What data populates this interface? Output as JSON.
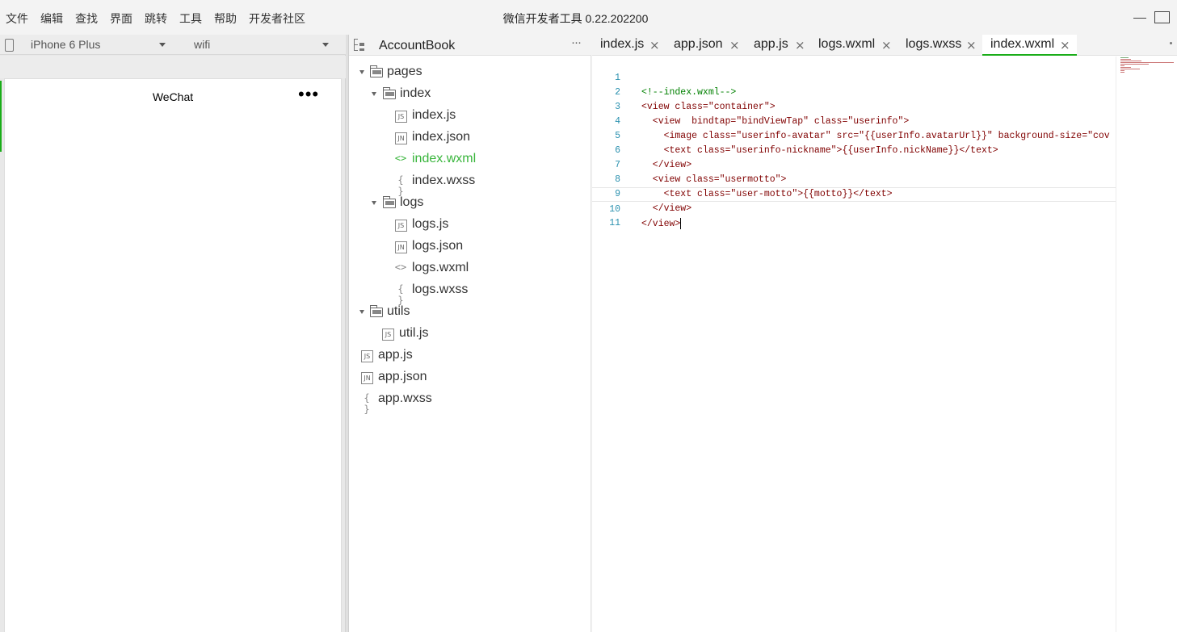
{
  "menu": [
    "文件",
    "编辑",
    "查找",
    "界面",
    "跳转",
    "工具",
    "帮助",
    "开发者社区"
  ],
  "app_title": "微信开发者工具 0.22.202200",
  "simulator": {
    "device": "iPhone 6 Plus",
    "network": "wifi",
    "nav_title": "WeChat",
    "nav_more": "•••"
  },
  "explorer": {
    "project_name": "AccountBook",
    "more": "···",
    "tree": [
      {
        "label": "pages",
        "kind": "folder"
      },
      {
        "label": "index",
        "kind": "folder"
      },
      {
        "label": "index.js",
        "kind": "js",
        "icon": "JS"
      },
      {
        "label": "index.json",
        "kind": "json",
        "icon": "JN"
      },
      {
        "label": "index.wxml",
        "kind": "wxml",
        "icon": "<>"
      },
      {
        "label": "index.wxss",
        "kind": "wxss",
        "icon": "{ }"
      },
      {
        "label": "logs",
        "kind": "folder"
      },
      {
        "label": "logs.js",
        "kind": "js",
        "icon": "JS"
      },
      {
        "label": "logs.json",
        "kind": "json",
        "icon": "JN"
      },
      {
        "label": "logs.wxml",
        "kind": "wxml",
        "icon": "<>"
      },
      {
        "label": "logs.wxss",
        "kind": "wxss",
        "icon": "{ }"
      },
      {
        "label": "utils",
        "kind": "folder"
      },
      {
        "label": "util.js",
        "kind": "js",
        "icon": "JS"
      },
      {
        "label": "app.js",
        "kind": "js",
        "icon": "JS"
      },
      {
        "label": "app.json",
        "kind": "json",
        "icon": "JN"
      },
      {
        "label": "app.wxss",
        "kind": "wxss",
        "icon": "{ }"
      }
    ]
  },
  "editor": {
    "tabs": [
      "index.js",
      "app.json",
      "app.js",
      "logs.wxml",
      "logs.wxss",
      "index.wxml"
    ],
    "active_tab": "index.wxml",
    "close_glyph": "×",
    "line_numbers": [
      "1",
      "2",
      "3",
      "4",
      "5",
      "6",
      "7",
      "8",
      "9",
      "10",
      "11"
    ],
    "code_lines": [
      "<!--index.wxml-->",
      "<view class=\"container\">",
      "  <view  bindtap=\"bindViewTap\" class=\"userinfo\">",
      "    <image class=\"userinfo-avatar\" src=\"{{userInfo.avatarUrl}}\" background-size=\"cov",
      "    <text class=\"userinfo-nickname\">{{userInfo.nickName}}</text>",
      "  </view>",
      "  <view class=\"usermotto\">",
      "    <text class=\"user-motto\">{{motto}}</text>",
      "  </view>",
      "</view>",
      ""
    ]
  },
  "colors": {
    "accent_green": "#1aad19",
    "active_file": "#38b53b",
    "line_number": "#2b91af"
  }
}
